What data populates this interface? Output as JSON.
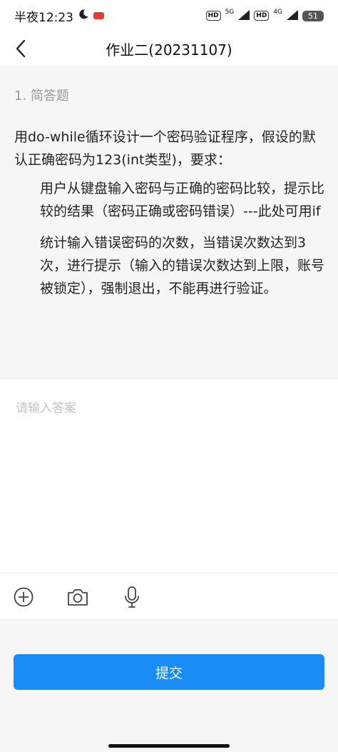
{
  "status_bar": {
    "time": "半夜12:23",
    "signal_1": "5G",
    "signal_2": "4G",
    "battery": "51",
    "hd_label": "HD"
  },
  "header": {
    "title": "作业二(20231107)"
  },
  "question": {
    "type_label": "1. 简答题",
    "intro": "用do-while循环设计一个密码验证程序，假设的默认正确密码为123(int类型)，要求：",
    "requirements": [
      "用户从键盘输入密码与正确的密码比较，提示比较的结果（密码正确或密码错误）---此处可用if",
      "统计输入错误密码的次数，当错误次数达到3次，进行提示（输入的错误次数达到上限，账号被锁定），强制退出，不能再进行验证。"
    ]
  },
  "answer": {
    "placeholder": "请输入答案",
    "value": ""
  },
  "toolbar": {
    "icons": [
      "add-icon",
      "camera-icon",
      "microphone-icon"
    ]
  },
  "submit": {
    "label": "提交"
  },
  "colors": {
    "accent": "#1a8cf5",
    "panel_bg": "#f6f6f6",
    "muted_text": "#999999"
  }
}
